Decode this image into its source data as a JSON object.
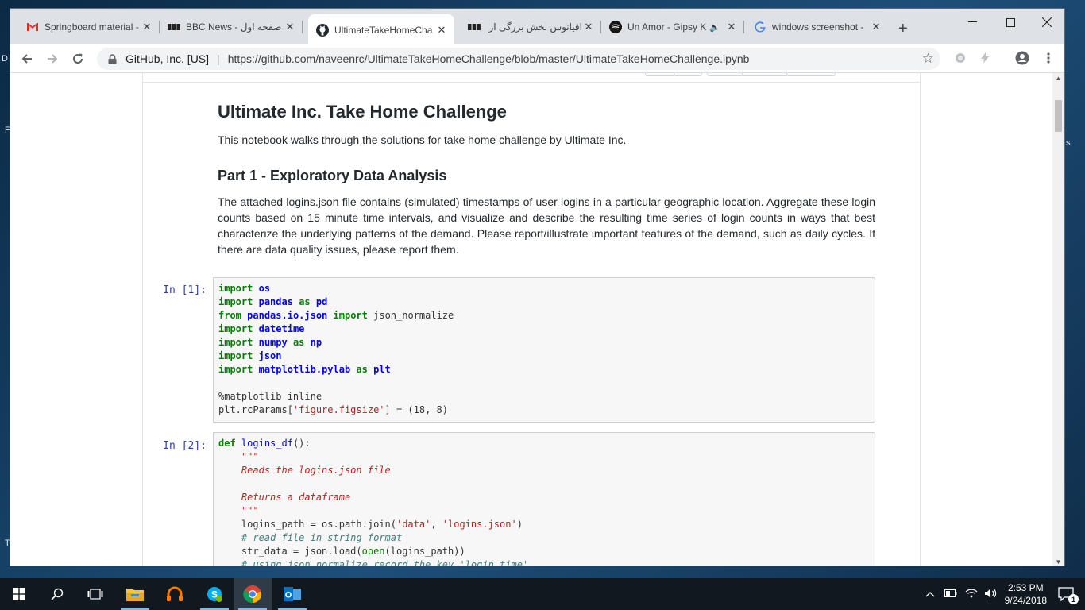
{
  "browser": {
    "tabs": [
      {
        "title": "Springboard material -",
        "icon": "gmail-icon",
        "active": false
      },
      {
        "title": "BBC News - صفحه اول",
        "icon": "bbc-icon",
        "active": false
      },
      {
        "title": "UltimateTakeHomeCha",
        "icon": "github-icon",
        "active": true
      },
      {
        "title": "اقیانوس بخش بزرگی از ز",
        "icon": "bbc-icon",
        "active": false
      },
      {
        "title": "Un Amor - Gipsy K",
        "icon": "spotify-icon",
        "active": false,
        "audio": true
      },
      {
        "title": "windows screenshot -",
        "icon": "google-icon",
        "active": false
      }
    ],
    "close_glyph": "✕",
    "new_tab_glyph": "+",
    "window_controls": {
      "minimize": "—",
      "maximize": "☐",
      "close": "✕"
    },
    "nav": {
      "back": "←",
      "forward": "→",
      "reload": "↻"
    },
    "address_bar": {
      "site_label": "GitHub, Inc. [US]",
      "separator": "|",
      "url": "https://github.com/naveenrc/UltimateTakeHomeChallenge/blob/master/UltimateTakeHomeChallenge.ipynb"
    },
    "star_glyph": "☆"
  },
  "notebook": {
    "title": "Ultimate Inc. Take Home Challenge",
    "intro": "This notebook walks through the solutions for take home challenge by Ultimate Inc.",
    "part1_heading": "Part 1 - Exploratory Data Analysis",
    "part1_text": "The attached logins.json file contains (simulated) timestamps of user logins in a particular geographic location. Aggregate these login counts based on 15 minute time intervals, and visualize and describe the resulting time series of login counts in ways that best characterize the underlying patterns of the demand. Please report/illustrate important features of the demand, such as daily cycles. If there are data quality issues, please report them.",
    "cells": [
      {
        "prompt": "In [1]:"
      },
      {
        "prompt": "In [2]:"
      }
    ]
  },
  "taskbar": {
    "clock_time": "2:53 PM",
    "clock_date": "9/24/2018",
    "notification_count": "1",
    "tray_up": "^"
  },
  "desktop": {
    "left_edge_letters": [
      "D",
      "F",
      "T"
    ],
    "right_edge_letter": "s"
  }
}
